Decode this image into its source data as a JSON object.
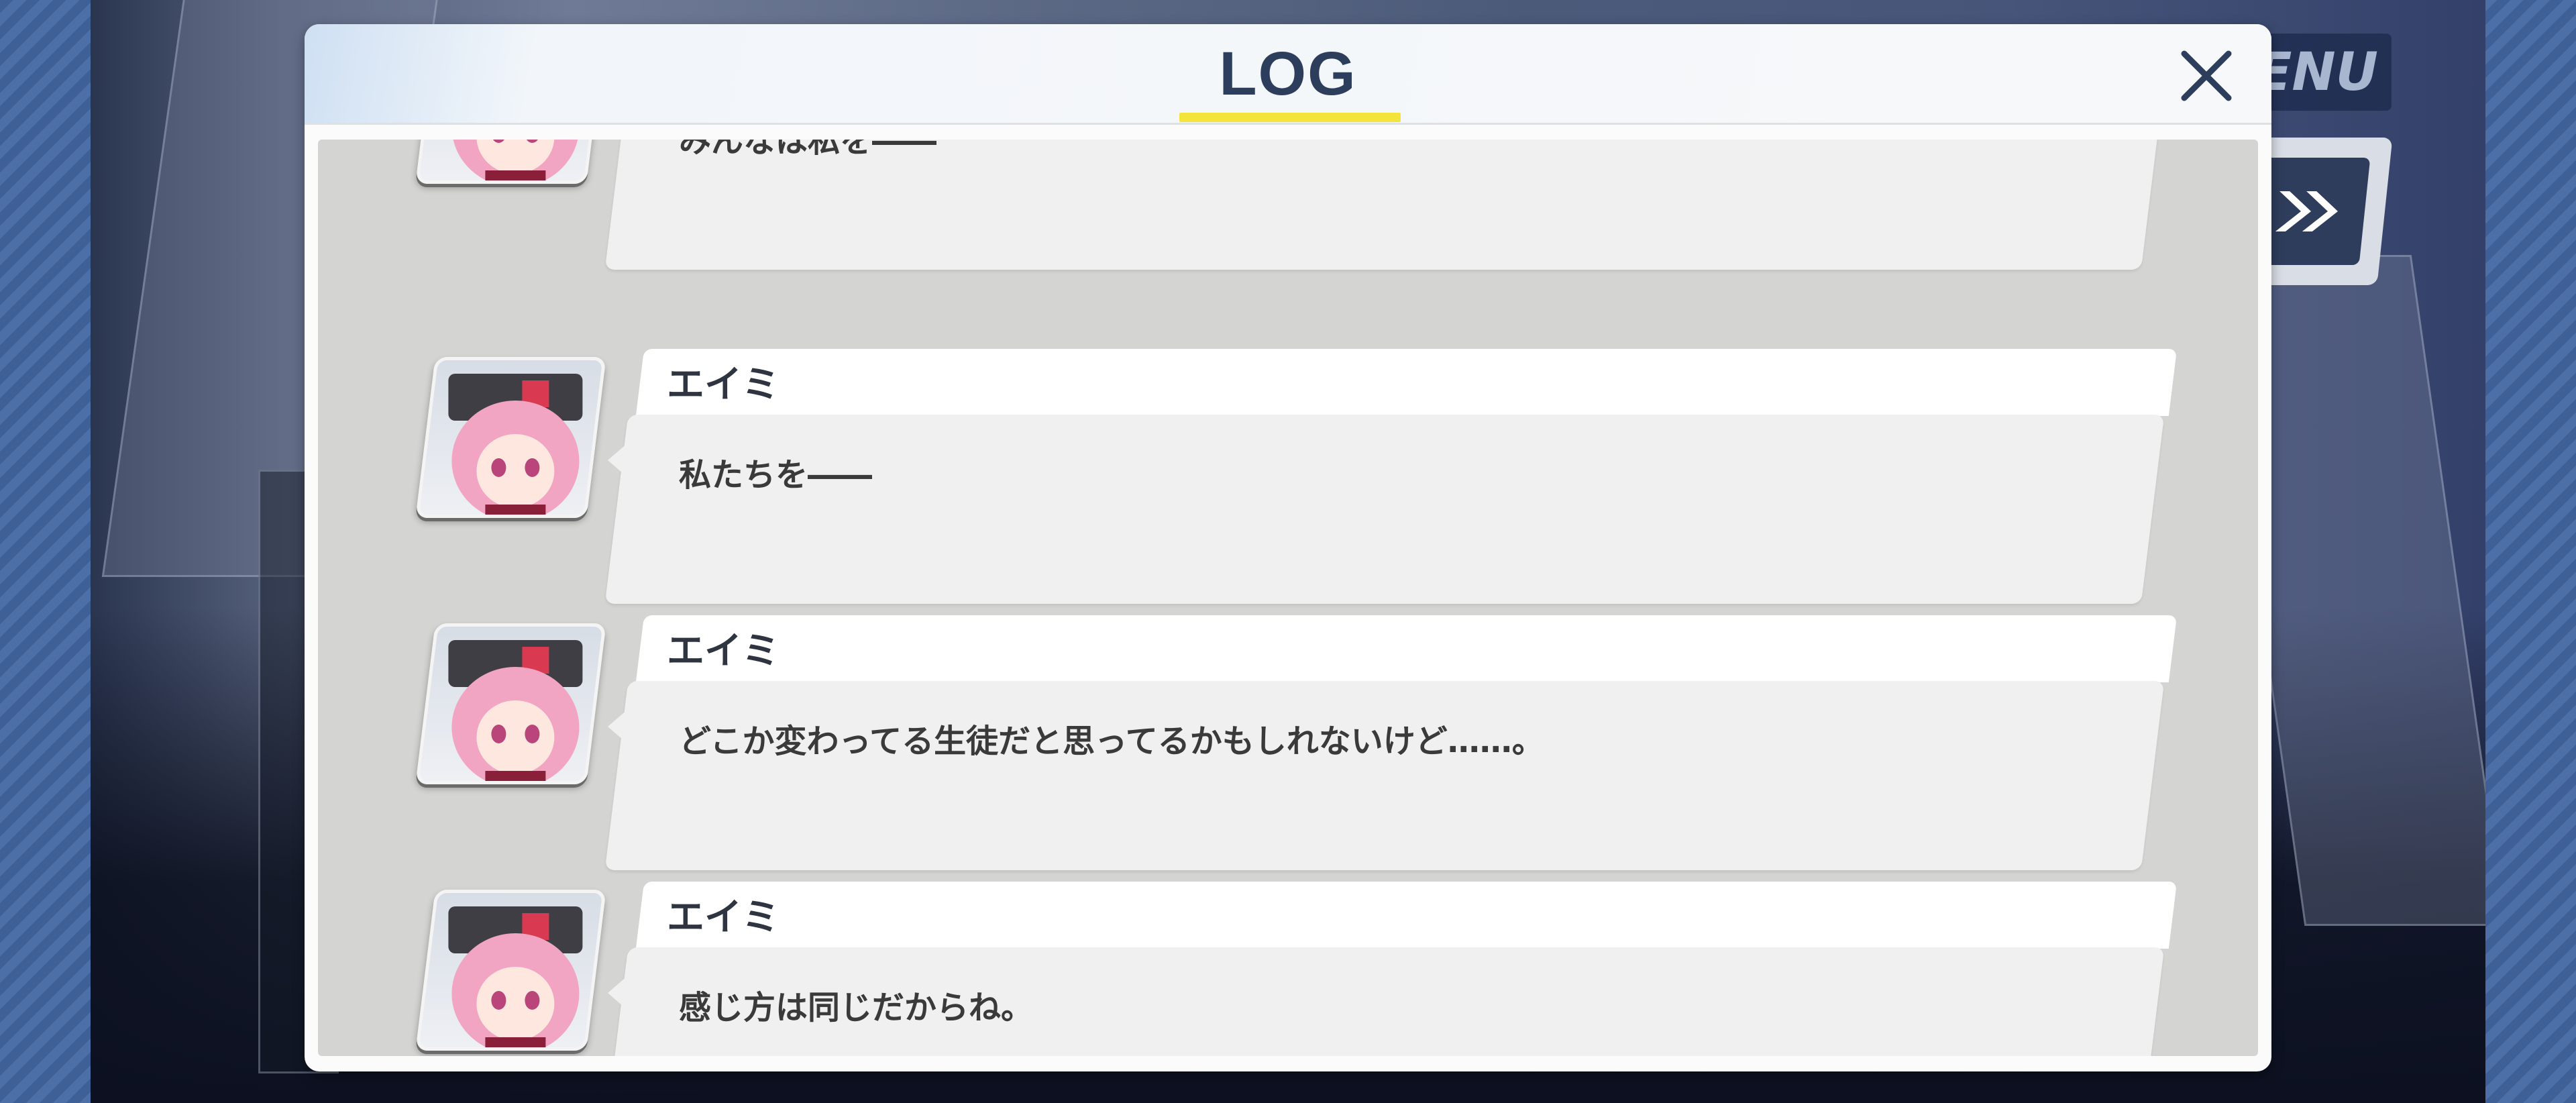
{
  "dialog": {
    "title": "LOG",
    "accent_color": "#f2e43a",
    "title_color": "#2d3e5c"
  },
  "hud": {
    "menu_label": "ENU",
    "skip_icon": "fast-forward-icon"
  },
  "entries": [
    {
      "speaker": "",
      "message": "みんなは私を――"
    },
    {
      "speaker": "エイミ",
      "message": "私たちを――"
    },
    {
      "speaker": "エイミ",
      "message": "どこか変わってる生徒だと思ってるかもしれないけど……。"
    },
    {
      "speaker": "エイミ",
      "message": "感じ方は同じだからね。"
    }
  ]
}
